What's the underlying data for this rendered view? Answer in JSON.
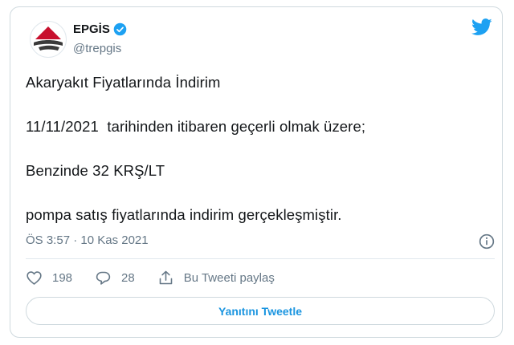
{
  "author": {
    "display_name": "EPGİS",
    "handle": "@trepgis",
    "verified": true
  },
  "tweet": {
    "lines": [
      "Akaryakıt Fiyatlarında İndirim",
      "11/11/2021  tarihinden itibaren geçerli olmak üzere;",
      "Benzinde 32 KRŞ/LT",
      "pompa satış fiyatlarında indirim gerçekleşmiştir."
    ],
    "timestamp": "ÖS 3:57 · 10 Kas 2021"
  },
  "actions": {
    "like_count": "198",
    "reply_count": "28",
    "share_label": "Bu Tweeti paylaş"
  },
  "reply_button_label": "Yanıtını Tweetle",
  "icons": {
    "brand": "twitter-logo-icon",
    "verified": "verified-badge-icon",
    "info": "info-icon",
    "like": "heart-icon",
    "reply": "speech-bubble-icon",
    "share": "share-upload-icon"
  },
  "colors": {
    "accent": "#1da1f2",
    "link": "#1b95e0",
    "muted": "#657786",
    "border": "#cfd9de",
    "logo_red": "#c8102e",
    "logo_dark": "#3a3a3a"
  }
}
